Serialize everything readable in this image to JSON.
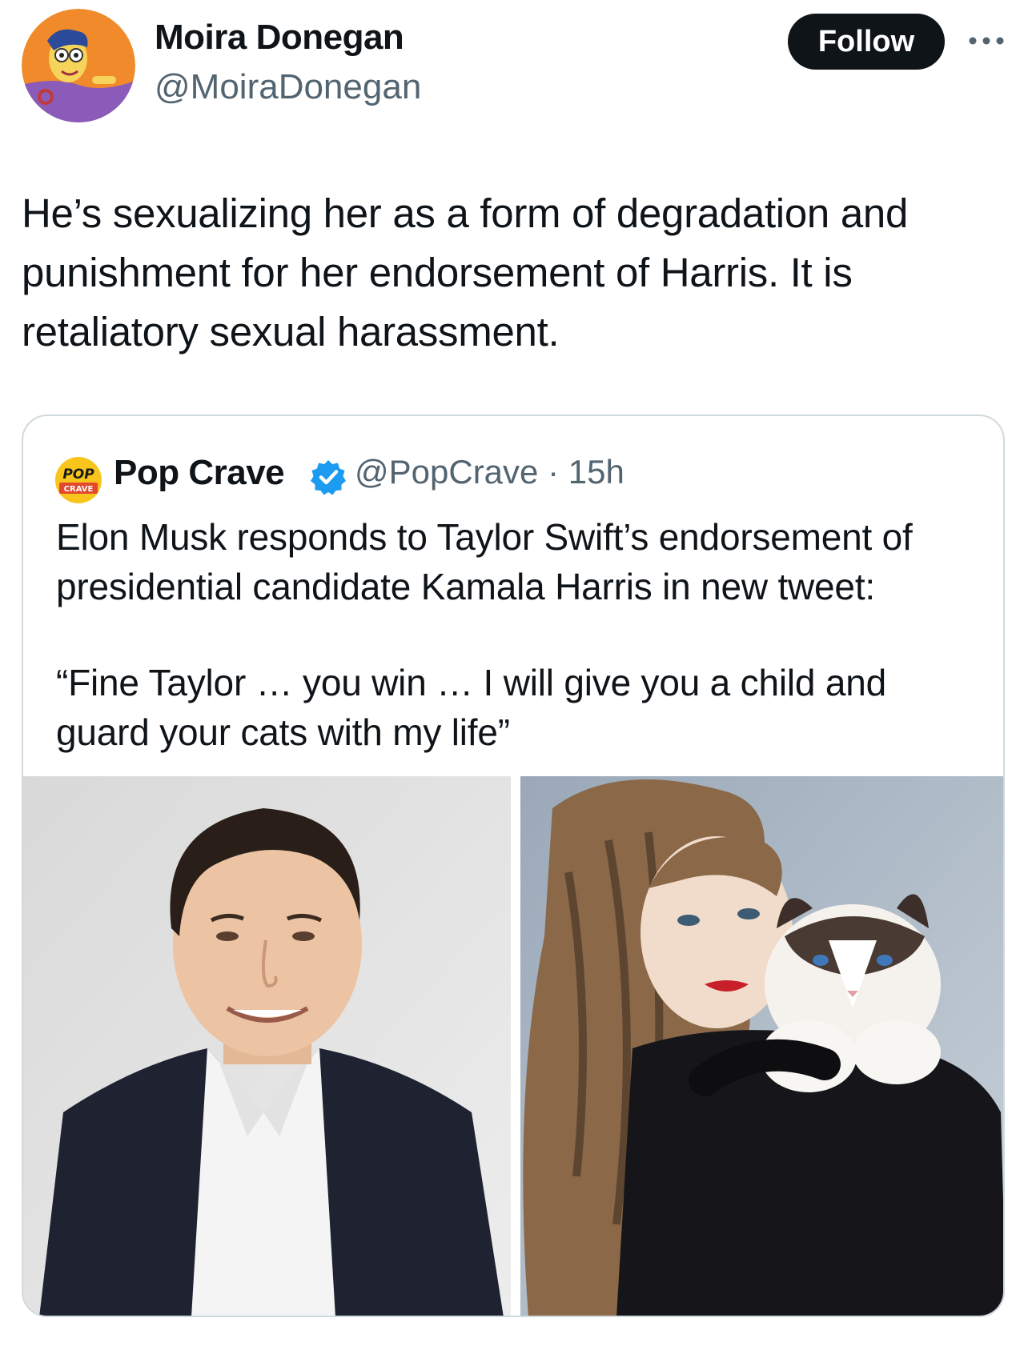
{
  "author": {
    "name": "Moira Donegan",
    "handle": "@MoiraDonegan",
    "avatar_icon": "cartoon-avatar"
  },
  "follow_label": "Follow",
  "more_icon": "more-horizontal-icon",
  "tweet_text": "He’s sexualizing her as a form of degradation and punishment for her endorsement of Harris. It is retaliatory sexual harassment.",
  "quote": {
    "author_name": "Pop Crave",
    "verified": true,
    "logo_text": "POP CRAVE",
    "meta": "@PopCrave · 15h",
    "text": "Elon Musk responds to Taylor Swift’s endorsement of presidential candidate Kamala Harris in new tweet:",
    "quoted": "“Fine Taylor … you win … I will give you a child and guard your cats with my life”",
    "images": [
      {
        "icon": "photo-man-in-suit"
      },
      {
        "icon": "photo-woman-with-cat"
      }
    ]
  },
  "colors": {
    "text": "#0f1419",
    "secondary": "#536471",
    "verified": "#1d9bf0",
    "border": "#cfd9de",
    "button": "#0f1419"
  }
}
